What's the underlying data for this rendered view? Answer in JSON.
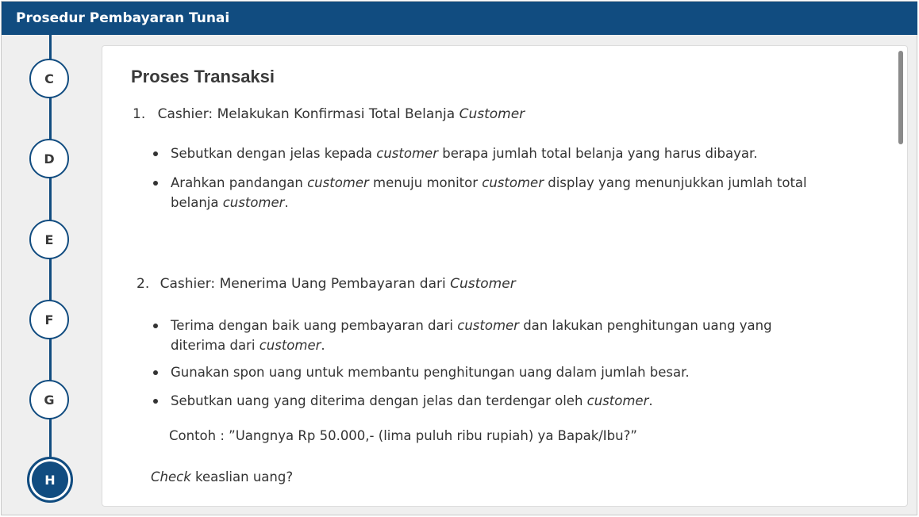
{
  "window": {
    "title": "Prosedur Pembayaran Tunai"
  },
  "steps": [
    "C",
    "D",
    "E",
    "F",
    "G",
    "H"
  ],
  "active_step": "H",
  "card": {
    "title": "Proses Transaksi",
    "section1": {
      "number": "1.",
      "heading_text": "Cashier: Melakukan Konfirmasi Total Belanja ",
      "heading_italic": "Customer",
      "bullet1": {
        "a": "Sebutkan dengan jelas kepada ",
        "b_italic": "customer",
        "c": " berapa jumlah total belanja yang harus dibayar."
      },
      "bullet2": {
        "a": "Arahkan pandangan ",
        "b_italic": "customer",
        "c": " menuju monitor ",
        "d_italic": "customer",
        "e": " display yang menunjukkan jumlah  total",
        "f": "belanja ",
        "g_italic": "customer",
        "h": "."
      }
    },
    "section2": {
      "number": "2.",
      "heading_text": "Cashier: Menerima Uang Pembayaran dari ",
      "heading_italic": "Customer",
      "bullet1": {
        "a": "Terima dengan baik uang pembayaran dari ",
        "b_italic": "customer",
        "c": " dan lakukan penghitungan uang yang",
        "d": "diterima dari ",
        "e_italic": "customer",
        "f": "."
      },
      "bullet2": {
        "a": "Gunakan spon uang untuk membantu penghitungan uang dalam jumlah besar."
      },
      "bullet3": {
        "a": "Sebutkan uang yang diterima  dengan jelas dan terdengar oleh ",
        "b_italic": "customer",
        "c": "."
      },
      "example": "Contoh : ”Uangnya Rp 50.000,- (lima puluh ribu rupiah) ya Bapak/Ibu?”",
      "check_italic": "Check",
      "check_rest": " keaslian uang?"
    }
  }
}
